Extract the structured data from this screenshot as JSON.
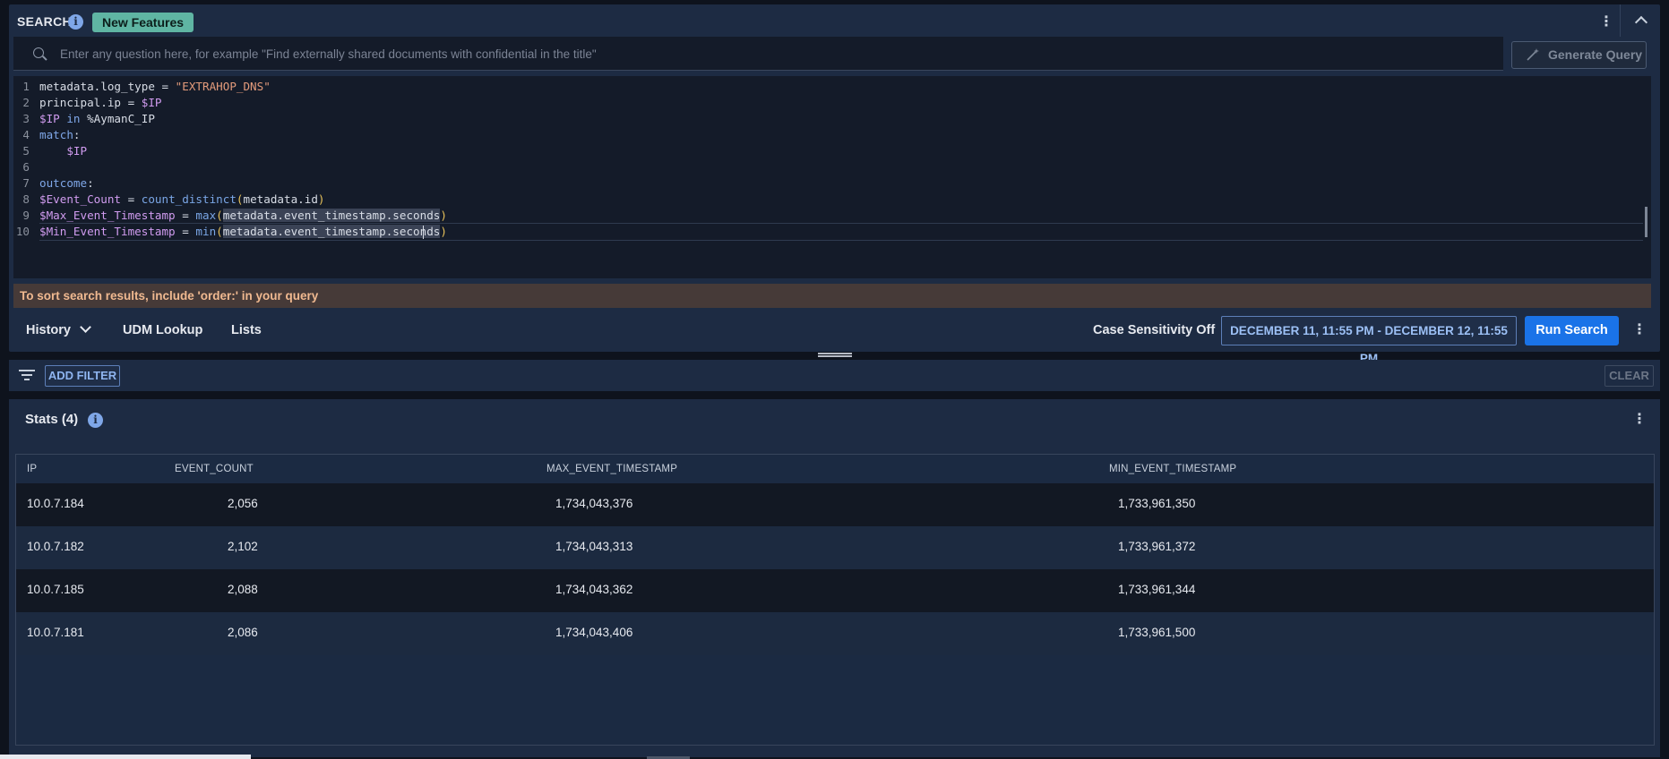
{
  "header": {
    "title": "SEARCH",
    "badge": "New Features"
  },
  "query_bar": {
    "placeholder": "Enter any question here, for example \"Find externally shared documents with confidential in the title\"",
    "generate_label": "Generate Query"
  },
  "editor": {
    "line_numbers": [
      "1",
      "2",
      "3",
      "4",
      "5",
      "6",
      "7",
      "8",
      "9",
      "10"
    ],
    "lines": [
      "metadata.log_type = \"EXTRAHOP_DNS\"",
      "principal.ip = $IP",
      "$IP in %AymanC_IP",
      "match:",
      "    $IP",
      "",
      "outcome:",
      "$Event_Count = count_distinct(metadata.id)",
      "$Max_Event_Timestamp = max(metadata.event_timestamp.seconds)",
      "$Min_Event_Timestamp = min(metadata.event_timestamp.seconds)"
    ]
  },
  "tip": "To sort search results, include 'order:' in your query",
  "toolbar": {
    "history_label": "History",
    "udm_label": "UDM Lookup",
    "lists_label": "Lists",
    "case_sensitivity": "Case Sensitivity Off",
    "date_range": "DECEMBER 11, 11:55 PM - DECEMBER 12, 11:55 PM",
    "run_label": "Run Search"
  },
  "filter_bar": {
    "add_filter_label": "ADD FILTER",
    "clear_label": "CLEAR"
  },
  "stats": {
    "title": "Stats (4)",
    "columns": [
      "IP",
      "EVENT_COUNT",
      "MAX_EVENT_TIMESTAMP",
      "MIN_EVENT_TIMESTAMP"
    ],
    "rows": [
      {
        "ip": "10.0.7.184",
        "event_count": "2,056",
        "max_ts": "1,734,043,376",
        "min_ts": "1,733,961,350"
      },
      {
        "ip": "10.0.7.182",
        "event_count": "2,102",
        "max_ts": "1,734,043,313",
        "min_ts": "1,733,961,372"
      },
      {
        "ip": "10.0.7.185",
        "event_count": "2,088",
        "max_ts": "1,734,043,362",
        "min_ts": "1,733,961,344"
      },
      {
        "ip": "10.0.7.181",
        "event_count": "2,086",
        "max_ts": "1,734,043,406",
        "min_ts": "1,733,961,500"
      }
    ]
  },
  "colors": {
    "accent": "#1a73e8",
    "badge": "#5fb5a3",
    "panel": "#1d2b43",
    "editor_bg": "#141b29",
    "tip_bg": "#463a38",
    "tip_text": "#f0b990"
  },
  "icons": {
    "header_info": "info-icon",
    "header_menu": "kebab-menu-icon",
    "collapse": "chevron-up-icon",
    "query_search": "search-icon",
    "generate": "magic-wand-icon",
    "history": "chevron-down-icon",
    "toolbar_menu": "kebab-menu-icon",
    "filter": "filter-icon",
    "stats_info": "info-icon",
    "stats_menu": "kebab-menu-icon"
  }
}
